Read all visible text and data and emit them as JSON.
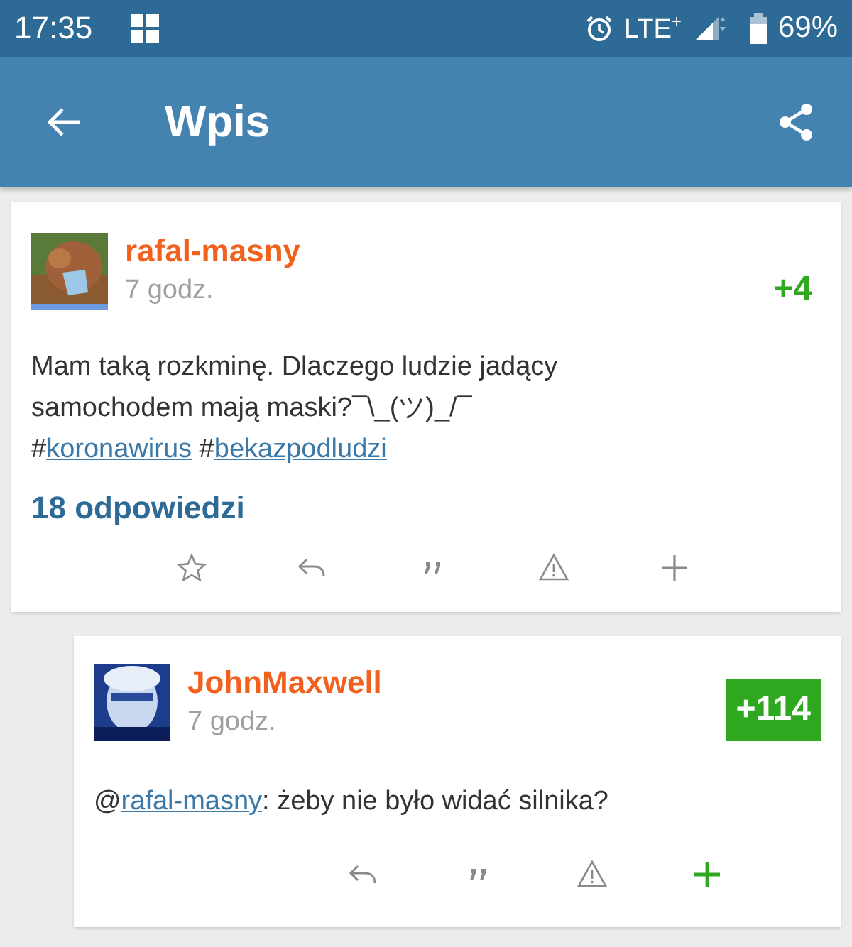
{
  "status_bar": {
    "time": "17:35",
    "network": "LTE$^{+}$",
    "battery": "69%"
  },
  "app_bar": {
    "title": "Wpis"
  },
  "post": {
    "author": "rafal-masny",
    "time": "7 godz.",
    "score": "+4",
    "voted": false,
    "text": "Mam taką rozkminę. Dlaczego ludzie jadący samochodem mają maski?¯\\_(ツ)_/¯",
    "tags": [
      {
        "prefix": "#",
        "label": "koronawirus"
      },
      {
        "prefix": "#",
        "label": "bekazpodludzi"
      }
    ],
    "replies": "18 odpowiedzi",
    "actions": [
      {
        "kind": "star"
      },
      {
        "kind": "reply"
      },
      {
        "kind": "quote"
      },
      {
        "kind": "report"
      },
      {
        "kind": "plus"
      }
    ]
  },
  "comment": {
    "author": "JohnMaxwell",
    "time": "7 godz.",
    "score": "+114",
    "voted": true,
    "mention_prefix": "@",
    "mention": "rafal-masny",
    "text": ": żeby nie było widać silnika?",
    "actions": [
      {
        "kind": "reply"
      },
      {
        "kind": "quote"
      },
      {
        "kind": "report"
      },
      {
        "kind": "plus"
      }
    ]
  }
}
